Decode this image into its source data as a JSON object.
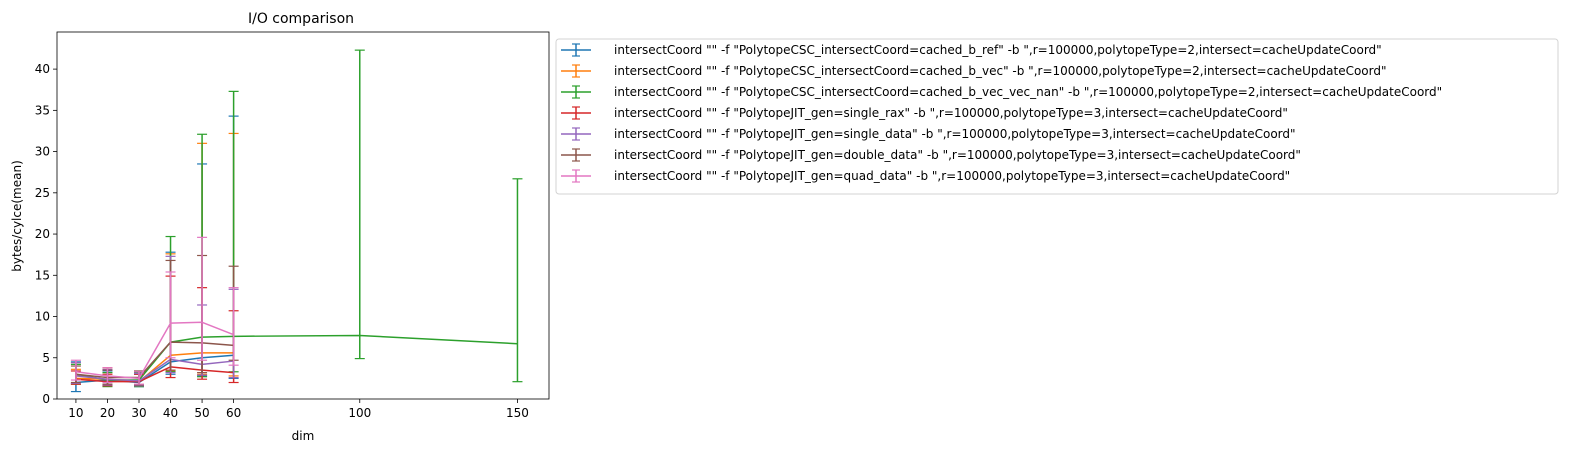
{
  "chart_data": {
    "type": "line",
    "title": "I/O comparison",
    "xlabel": "dim",
    "ylabel": "bytes/cylce(mean)",
    "xlim": [
      4,
      160
    ],
    "ylim": [
      0,
      44.5
    ],
    "xticks": [
      10,
      20,
      30,
      40,
      50,
      60,
      100,
      150
    ],
    "yticks": [
      0,
      5,
      10,
      15,
      20,
      25,
      30,
      35,
      40
    ],
    "grid": false,
    "legend_position": "outside-right",
    "series": [
      {
        "name": "intersectCoord \"\" -f \"PolytopeCSC_intersectCoord=cached_b_ref\" -b \",r=100000,polytopeType=2,intersect=cacheUpdateCoord\"",
        "color": "#1f77b4",
        "x": [
          10,
          20,
          30,
          40,
          50,
          60
        ],
        "y": [
          2.0,
          2.3,
          2.0,
          4.5,
          5.0,
          5.3
        ],
        "err_low": [
          0.9,
          1.6,
          1.5,
          3.0,
          2.8,
          2.5
        ],
        "err_high": [
          4.5,
          3.4,
          3.0,
          17.8,
          28.5,
          34.3
        ]
      },
      {
        "name": "intersectCoord \"\" -f \"PolytopeCSC_intersectCoord=cached_b_vec\" -b \",r=100000,polytopeType=2,intersect=cacheUpdateCoord\"",
        "color": "#ff7f0e",
        "x": [
          10,
          20,
          30,
          40,
          50,
          60
        ],
        "y": [
          2.5,
          2.4,
          2.1,
          5.3,
          5.6,
          5.6
        ],
        "err_low": [
          1.8,
          1.7,
          1.6,
          3.4,
          3.0,
          2.8
        ],
        "err_high": [
          3.6,
          3.8,
          3.2,
          17.6,
          31.0,
          32.2
        ]
      },
      {
        "name": "intersectCoord \"\" -f \"PolytopeCSC_intersectCoord=cached_b_vec_vec_nan\" -b \",r=100000,polytopeType=2,intersect=cacheUpdateCoord\"",
        "color": "#2ca02c",
        "x": [
          10,
          20,
          30,
          40,
          50,
          60,
          100,
          150
        ],
        "y": [
          3.0,
          2.3,
          2.3,
          6.9,
          7.5,
          7.6,
          7.7,
          6.7
        ],
        "err_low": [
          1.8,
          1.5,
          1.5,
          3.3,
          2.7,
          3.3,
          4.9,
          2.1
        ],
        "err_high": [
          4.2,
          3.2,
          3.2,
          19.7,
          32.1,
          37.3,
          42.3,
          26.7
        ]
      },
      {
        "name": "intersectCoord \"\" -f \"PolytopeJIT_gen=single_rax\" -b \",r=100000,polytopeType=3,intersect=cacheUpdateCoord\"",
        "color": "#d62728",
        "x": [
          10,
          20,
          30,
          40,
          50,
          60
        ],
        "y": [
          2.4,
          2.1,
          2.1,
          3.9,
          3.5,
          3.2
        ],
        "err_low": [
          1.8,
          1.6,
          1.6,
          2.6,
          2.4,
          2.0
        ],
        "err_high": [
          3.4,
          3.0,
          3.0,
          14.9,
          13.5,
          10.7
        ]
      },
      {
        "name": "intersectCoord \"\" -f \"PolytopeJIT_gen=single_data\" -b \",r=100000,polytopeType=3,intersect=cacheUpdateCoord\"",
        "color": "#9467bd",
        "x": [
          10,
          20,
          30,
          40,
          50,
          60
        ],
        "y": [
          2.8,
          2.4,
          2.2,
          4.8,
          4.2,
          4.6
        ],
        "err_low": [
          1.9,
          1.7,
          1.6,
          3.2,
          2.9,
          2.6
        ],
        "err_high": [
          4.4,
          3.6,
          3.1,
          17.3,
          11.4,
          13.3
        ]
      },
      {
        "name": "intersectCoord \"\" -f \"PolytopeJIT_gen=double_data\" -b \",r=100000,polytopeType=3,intersect=cacheUpdateCoord\"",
        "color": "#8c564b",
        "x": [
          10,
          20,
          30,
          40,
          50,
          60
        ],
        "y": [
          3.0,
          2.6,
          2.6,
          6.9,
          6.8,
          6.5
        ],
        "err_low": [
          2.0,
          1.8,
          1.7,
          3.5,
          3.2,
          4.7
        ],
        "err_high": [
          4.0,
          3.5,
          3.4,
          16.8,
          17.4,
          16.1
        ]
      },
      {
        "name": "intersectCoord \"\" -f \"PolytopeJIT_gen=quad_data\" -b \",r=100000,polytopeType=3,intersect=cacheUpdateCoord\"",
        "color": "#e377c2",
        "x": [
          10,
          20,
          30,
          40,
          50,
          60
        ],
        "y": [
          3.3,
          2.8,
          2.5,
          9.2,
          9.3,
          7.8
        ],
        "err_low": [
          2.3,
          2.0,
          1.8,
          5.0,
          4.7,
          4.1
        ],
        "err_high": [
          4.7,
          3.8,
          3.3,
          15.4,
          19.6,
          13.5
        ]
      }
    ]
  }
}
